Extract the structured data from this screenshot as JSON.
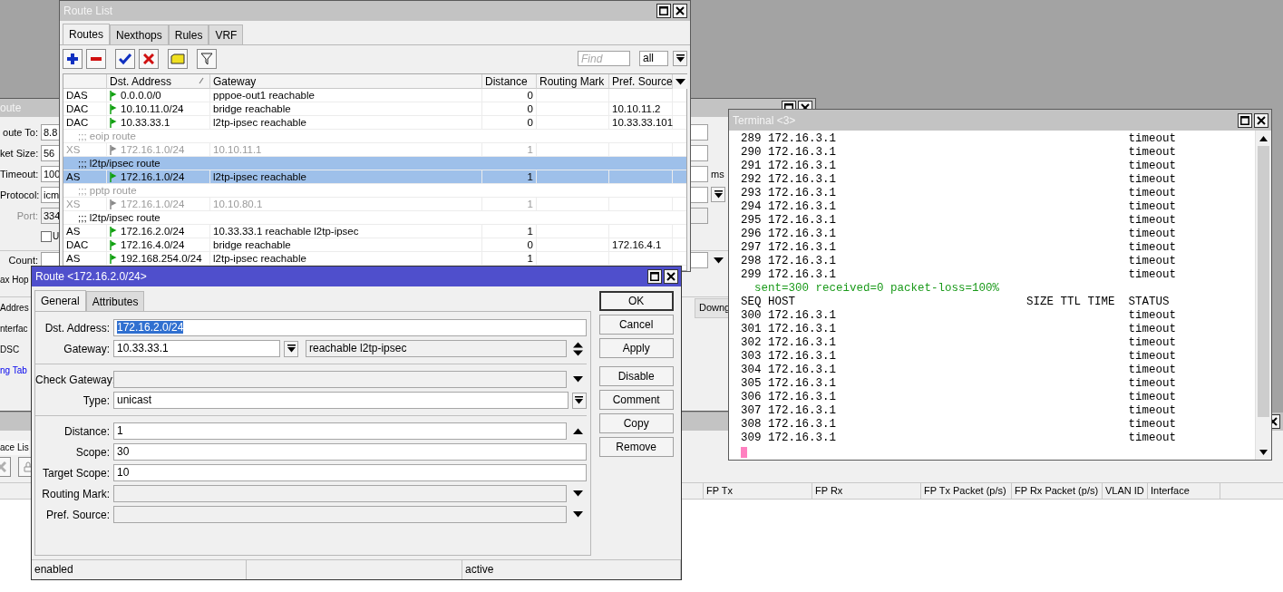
{
  "ping_window": {
    "title": "oute",
    "sections": [
      [
        {
          "kind": "field",
          "label": "oute To:",
          "value": "8.8",
          "disabled": false
        },
        {
          "kind": "field",
          "label": "ket Size:",
          "value": "56",
          "disabled": false
        },
        {
          "kind": "field",
          "label": "Timeout:",
          "value": "100",
          "unit": "ms",
          "disabled": false
        },
        {
          "kind": "dropdown",
          "label": "Protocol:",
          "value": "icm"
        },
        {
          "kind": "field",
          "label": "Port:",
          "value": "334",
          "disabled": true
        },
        {
          "kind": "checkbox",
          "label": "U",
          "checked": false
        }
      ],
      [
        {
          "kind": "combo",
          "label": "Count:"
        },
        {
          "kind": "label",
          "label": "ax Hop"
        }
      ],
      [
        {
          "kind": "label",
          "label": "Addres",
          "side_label": "Downg"
        },
        {
          "kind": "label",
          "label": "nterfac"
        },
        {
          "kind": "label",
          "label": "DSC"
        },
        {
          "kind": "link",
          "label": "ng Tab"
        }
      ]
    ]
  },
  "interface_window": {
    "tab": "ace Lis",
    "columns": [
      "FP Tx",
      "FP Rx",
      "FP Tx Packet (p/s)",
      "FP Rx Packet (p/s)",
      "VLAN ID",
      "Interface"
    ]
  },
  "route_list": {
    "title": "Route List",
    "tabs": [
      {
        "label": "Routes",
        "selected": true
      },
      {
        "label": "Nexthops",
        "selected": false
      },
      {
        "label": "Rules",
        "selected": false
      },
      {
        "label": "VRF",
        "selected": false
      }
    ],
    "find": {
      "placeholder": "Find"
    },
    "filter": {
      "value": "all"
    },
    "columns": [
      {
        "label": "Dst. Address",
        "sorted": true
      },
      {
        "label": "Gateway",
        "sorted": false
      },
      {
        "label": "Distance",
        "sorted": false
      },
      {
        "label": "Routing Mark",
        "sorted": false
      },
      {
        "label": "Pref. Source",
        "sorted": false
      }
    ],
    "rows": [
      {
        "kind": "route",
        "flags": "DAS",
        "dst": "0.0.0.0/0",
        "gateway": "pppoe-out1 reachable",
        "distance": "0",
        "disabled": false,
        "selected": false
      },
      {
        "kind": "route",
        "flags": "DAC",
        "dst": "10.10.11.0/24",
        "gateway": "bridge reachable",
        "distance": "0",
        "pref_source": "10.10.11.2",
        "disabled": false,
        "selected": false
      },
      {
        "kind": "route",
        "flags": "DAC",
        "dst": "10.33.33.1",
        "gateway": "l2tp-ipsec reachable",
        "distance": "0",
        "pref_source": "10.33.33.101",
        "disabled": false,
        "selected": false
      },
      {
        "kind": "comment",
        "text": ";;; eoip route",
        "disabled": true,
        "selected": false
      },
      {
        "kind": "route",
        "flags": "XS",
        "dst": "172.16.1.0/24",
        "gateway": "10.10.11.1",
        "distance": "1",
        "disabled": true,
        "selected": false
      },
      {
        "kind": "comment",
        "text": ";;; l2tp/ipsec route",
        "disabled": false,
        "selected": true
      },
      {
        "kind": "route",
        "flags": "AS",
        "dst": "172.16.1.0/24",
        "gateway": "l2tp-ipsec reachable",
        "distance": "1",
        "disabled": false,
        "selected": true
      },
      {
        "kind": "comment",
        "text": ";;; pptp route",
        "disabled": true,
        "selected": false
      },
      {
        "kind": "route",
        "flags": "XS",
        "dst": "172.16.1.0/24",
        "gateway": "10.10.80.1",
        "distance": "1",
        "disabled": true,
        "selected": false
      },
      {
        "kind": "comment",
        "text": ";;; l2tp/ipsec route",
        "disabled": false,
        "selected": false
      },
      {
        "kind": "route",
        "flags": "AS",
        "dst": "172.16.2.0/24",
        "gateway": "10.33.33.1 reachable l2tp-ipsec",
        "distance": "1",
        "disabled": false,
        "selected": false
      },
      {
        "kind": "route",
        "flags": "DAC",
        "dst": "172.16.4.0/24",
        "gateway": "bridge reachable",
        "distance": "0",
        "pref_source": "172.16.4.1",
        "disabled": false,
        "selected": false
      },
      {
        "kind": "route",
        "flags": "AS",
        "dst": "192.168.254.0/24",
        "gateway": "l2tp-ipsec reachable",
        "distance": "1",
        "disabled": false,
        "selected": false
      }
    ]
  },
  "terminal": {
    "title": "Terminal <3>",
    "lines": [
      {
        "kind": "reply",
        "seq": "289",
        "host": "172.16.3.1",
        "status": "timeout"
      },
      {
        "kind": "reply",
        "seq": "290",
        "host": "172.16.3.1",
        "status": "timeout"
      },
      {
        "kind": "reply",
        "seq": "291",
        "host": "172.16.3.1",
        "status": "timeout"
      },
      {
        "kind": "reply",
        "seq": "292",
        "host": "172.16.3.1",
        "status": "timeout"
      },
      {
        "kind": "reply",
        "seq": "293",
        "host": "172.16.3.1",
        "status": "timeout"
      },
      {
        "kind": "reply",
        "seq": "294",
        "host": "172.16.3.1",
        "status": "timeout"
      },
      {
        "kind": "reply",
        "seq": "295",
        "host": "172.16.3.1",
        "status": "timeout"
      },
      {
        "kind": "reply",
        "seq": "296",
        "host": "172.16.3.1",
        "status": "timeout"
      },
      {
        "kind": "reply",
        "seq": "297",
        "host": "172.16.3.1",
        "status": "timeout"
      },
      {
        "kind": "reply",
        "seq": "298",
        "host": "172.16.3.1",
        "status": "timeout"
      },
      {
        "kind": "reply",
        "seq": "299",
        "host": "172.16.3.1",
        "status": "timeout"
      },
      {
        "kind": "summary",
        "text": "sent=300 received=0 packet-loss=100%"
      },
      {
        "kind": "header",
        "columns": [
          "SEQ",
          "HOST",
          "SIZE",
          "TTL",
          "TIME",
          "STATUS"
        ]
      },
      {
        "kind": "reply",
        "seq": "300",
        "host": "172.16.3.1",
        "status": "timeout"
      },
      {
        "kind": "reply",
        "seq": "301",
        "host": "172.16.3.1",
        "status": "timeout"
      },
      {
        "kind": "reply",
        "seq": "302",
        "host": "172.16.3.1",
        "status": "timeout"
      },
      {
        "kind": "reply",
        "seq": "303",
        "host": "172.16.3.1",
        "status": "timeout"
      },
      {
        "kind": "reply",
        "seq": "304",
        "host": "172.16.3.1",
        "status": "timeout"
      },
      {
        "kind": "reply",
        "seq": "305",
        "host": "172.16.3.1",
        "status": "timeout"
      },
      {
        "kind": "reply",
        "seq": "306",
        "host": "172.16.3.1",
        "status": "timeout"
      },
      {
        "kind": "reply",
        "seq": "307",
        "host": "172.16.3.1",
        "status": "timeout"
      },
      {
        "kind": "reply",
        "seq": "308",
        "host": "172.16.3.1",
        "status": "timeout"
      },
      {
        "kind": "reply",
        "seq": "309",
        "host": "172.16.3.1",
        "status": "timeout"
      }
    ]
  },
  "route_dialog": {
    "title": "Route <172.16.2.0/24>",
    "tabs": [
      {
        "label": "General",
        "selected": true
      },
      {
        "label": "Attributes",
        "selected": false
      }
    ],
    "sections": [
      [
        {
          "kind": "text",
          "label": "Dst. Address:",
          "value": "172.16.2.0/24",
          "highlighted": true
        },
        {
          "kind": "gateway",
          "label": "Gateway:",
          "value": "10.33.33.1",
          "status": "reachable l2tp-ipsec"
        }
      ],
      [
        {
          "kind": "optional",
          "label": "Check Gateway:"
        },
        {
          "kind": "dropdown",
          "label": "Type:",
          "value": "unicast"
        }
      ],
      [
        {
          "kind": "collapsible",
          "label": "Distance:",
          "value": "1"
        },
        {
          "kind": "text",
          "label": "Scope:",
          "value": "30",
          "highlighted": false
        },
        {
          "kind": "text",
          "label": "Target Scope:",
          "value": "10",
          "highlighted": false
        },
        {
          "kind": "optional",
          "label": "Routing Mark:"
        },
        {
          "kind": "optional",
          "label": "Pref. Source:"
        }
      ]
    ],
    "button_groups": [
      [
        {
          "label": "OK",
          "default": true
        },
        {
          "label": "Cancel",
          "default": false
        },
        {
          "label": "Apply",
          "default": false
        }
      ],
      [
        {
          "label": "Disable",
          "default": false
        },
        {
          "label": "Comment",
          "default": false
        },
        {
          "label": "Copy",
          "default": false
        },
        {
          "label": "Remove",
          "default": false
        }
      ]
    ],
    "status_bar": {
      "left": "enabled",
      "right": "active"
    }
  }
}
